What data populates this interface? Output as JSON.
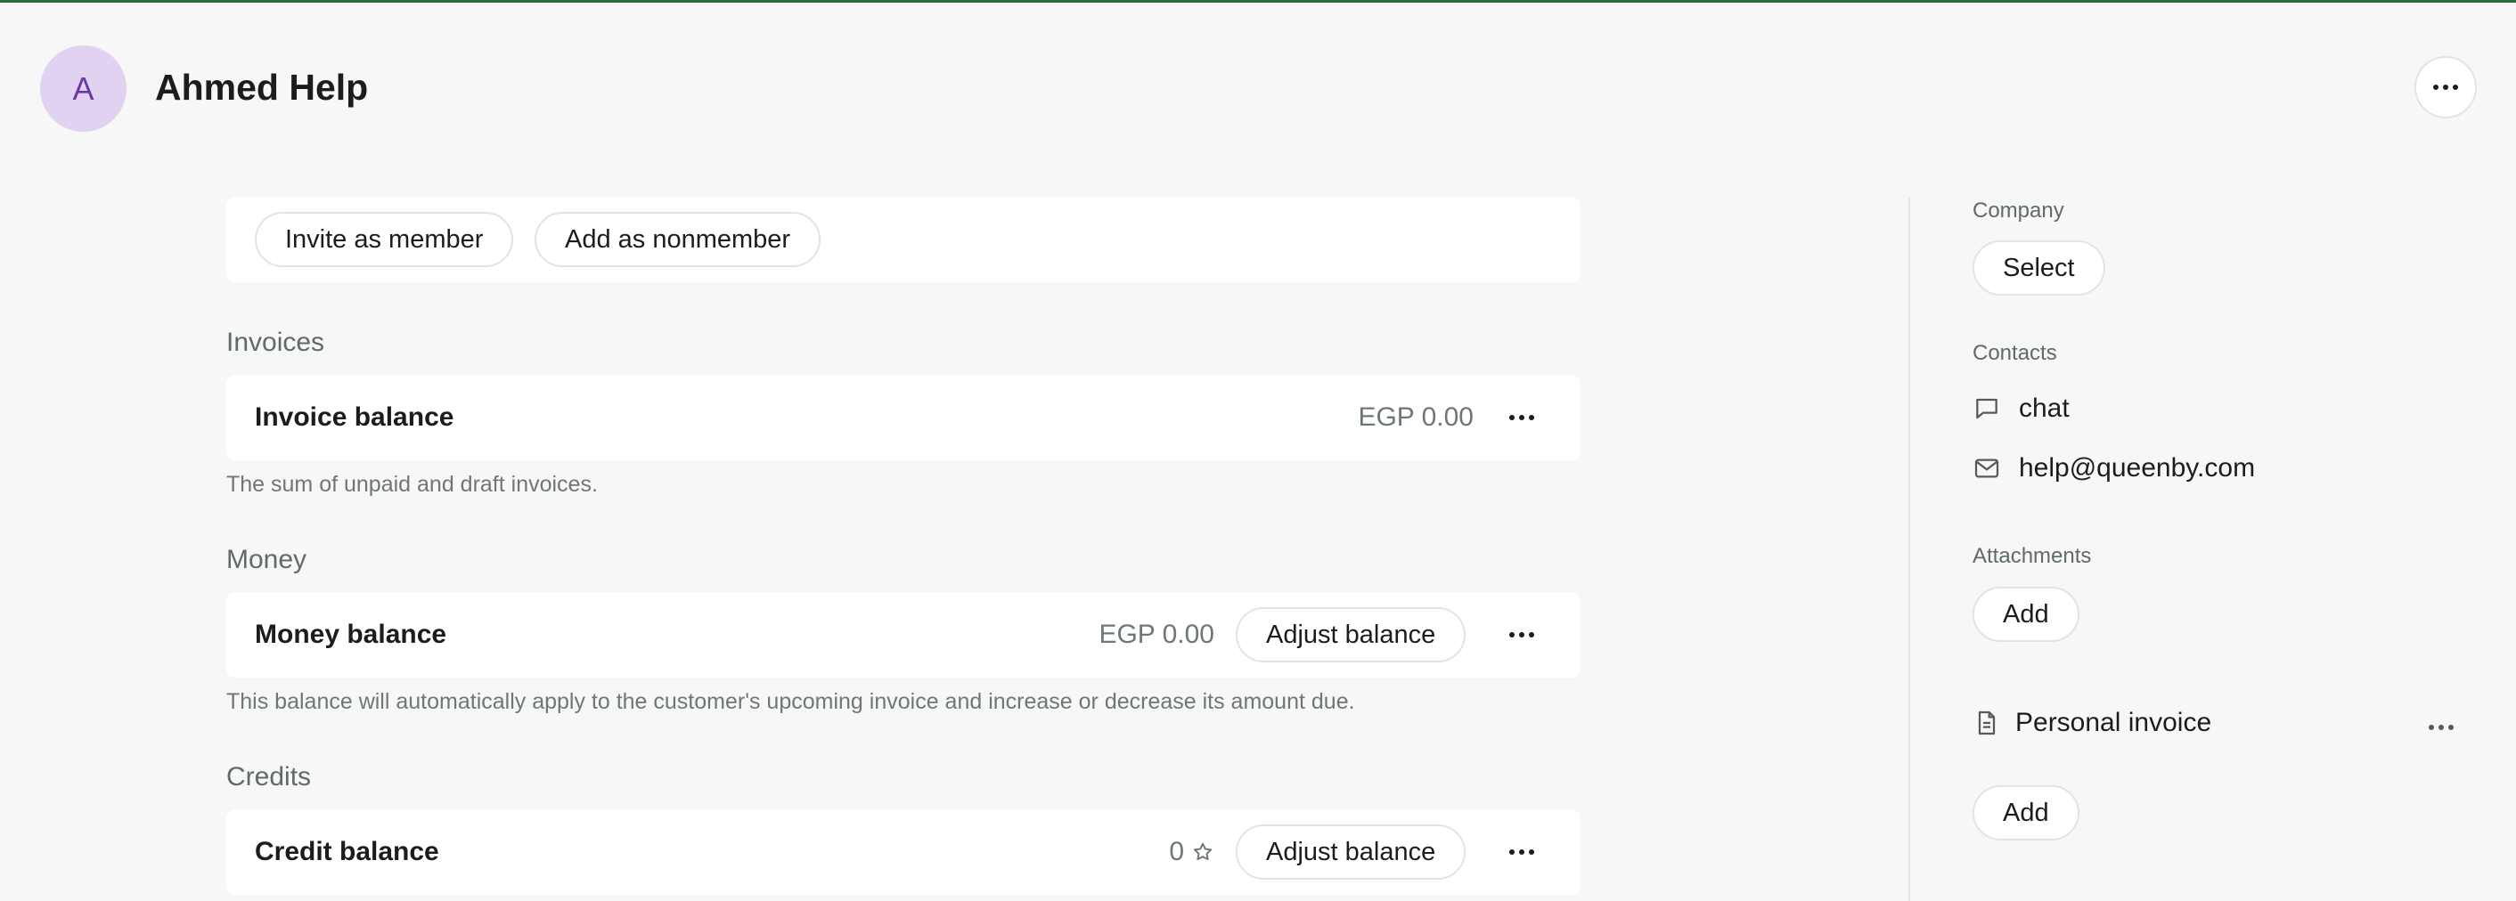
{
  "header": {
    "avatar_initial": "A",
    "name": "Ahmed Help",
    "more_icon": "more-horizontal-icon"
  },
  "actions": {
    "invite_label": "Invite as member",
    "nonmember_label": "Add as nonmember"
  },
  "invoices": {
    "section_title": "Invoices",
    "row_label": "Invoice balance",
    "value": "EGP 0.00",
    "helper": "The sum of unpaid and draft invoices."
  },
  "money": {
    "section_title": "Money",
    "row_label": "Money balance",
    "value": "EGP 0.00",
    "adjust_label": "Adjust balance",
    "helper": "This balance will automatically apply to the customer's upcoming invoice and increase or decrease its amount due."
  },
  "credits": {
    "section_title": "Credits",
    "row_label": "Credit balance",
    "value": "0",
    "value_icon": "star-icon",
    "adjust_label": "Adjust balance"
  },
  "sidebar": {
    "company_label": "Company",
    "company_select": "Select",
    "contacts_label": "Contacts",
    "contacts": [
      {
        "icon": "chat-icon",
        "text": "chat"
      },
      {
        "icon": "mail-icon",
        "text": "help@queenby.com"
      }
    ],
    "attachments_label": "Attachments",
    "attachments_add": "Add",
    "attachment_name": "Personal invoice",
    "attachment_icon": "document-icon",
    "second_add": "Add"
  },
  "colors": {
    "background": "#f6f7f6",
    "card": "#ffffff",
    "avatar_bg": "#e2d2f1",
    "avatar_fg": "#6b3aa3",
    "top_accent": "#2e6b45",
    "muted_text": "#6d7874"
  }
}
